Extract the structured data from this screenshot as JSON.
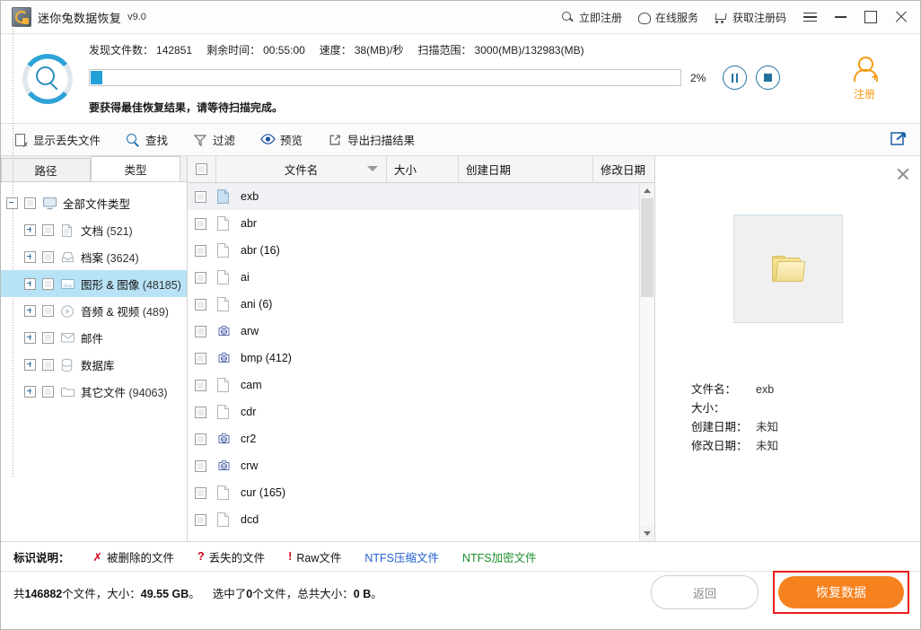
{
  "titlebar": {
    "app_name": "迷你兔数据恢复",
    "version": "v9.0",
    "links": [
      {
        "label": "立即注册",
        "icon": "search-icon"
      },
      {
        "label": "在线服务",
        "icon": "headset-icon"
      },
      {
        "label": "获取注册码",
        "icon": "cart-icon"
      }
    ],
    "window_controls": [
      "menu-icon",
      "minimize-icon",
      "maximize-icon",
      "close-icon"
    ]
  },
  "scan": {
    "stats": [
      {
        "label": "发现文件数：",
        "value": "142851"
      },
      {
        "label": "剩余时间：",
        "value": "00:55:00"
      },
      {
        "label": "速度：",
        "value": "38(MB)/秒"
      },
      {
        "label": "扫描范围：",
        "value": "3000(MB)/132983(MB)"
      }
    ],
    "progress_percent": "2%",
    "progress_value": 2,
    "hint": "要获得最佳恢复结果，请等待扫描完成。",
    "pause_label": "pause-button",
    "stop_label": "stop-button",
    "register_label": "注册",
    "accent_color": "#22a0d8",
    "register_color": "#f59a12"
  },
  "toolbar": {
    "items": [
      {
        "label": "显示丢失文件",
        "icon": "document-missing-icon"
      },
      {
        "label": "查找",
        "icon": "search-icon"
      },
      {
        "label": "过滤",
        "icon": "filter-icon"
      },
      {
        "label": "预览",
        "icon": "eye-icon"
      },
      {
        "label": "导出扫描结果",
        "icon": "export-icon"
      }
    ],
    "share_icon": "share-export-icon"
  },
  "left_panel": {
    "tabs": [
      {
        "label": "路径",
        "active": false
      },
      {
        "label": "类型",
        "active": true
      }
    ],
    "tree": [
      {
        "label": "全部文件类型",
        "count": "",
        "icon": "monitor-icon",
        "level": 0,
        "expander": "minus",
        "selected": false
      },
      {
        "label": "文档",
        "count": "(521)",
        "icon": "document-icon",
        "level": 1,
        "expander": "plus",
        "selected": false
      },
      {
        "label": "档案",
        "count": "(3624)",
        "icon": "archive-icon",
        "level": 1,
        "expander": "plus",
        "selected": false
      },
      {
        "label": "图形 & 图像",
        "count": "(48185)",
        "icon": "image-icon",
        "level": 1,
        "expander": "plus",
        "selected": true
      },
      {
        "label": "音频 & 视频",
        "count": "(489)",
        "icon": "media-icon",
        "level": 1,
        "expander": "plus",
        "selected": false
      },
      {
        "label": "邮件",
        "count": "",
        "icon": "mail-icon",
        "level": 1,
        "expander": "plus",
        "selected": false
      },
      {
        "label": "数据库",
        "count": "",
        "icon": "database-icon",
        "level": 1,
        "expander": "plus",
        "selected": false
      },
      {
        "label": "其它文件",
        "count": "(94063)",
        "icon": "folder-icon",
        "level": 1,
        "expander": "plus",
        "selected": false
      }
    ]
  },
  "file_list": {
    "columns": [
      {
        "label": "文件名",
        "sorted": "desc"
      },
      {
        "label": "大小",
        "sorted": ""
      },
      {
        "label": "创建日期",
        "sorted": ""
      },
      {
        "label": "修改日期",
        "sorted": ""
      }
    ],
    "rows": [
      {
        "name": "exb",
        "icon": "blue-file-icon",
        "size": "",
        "created": "",
        "modified": "",
        "selected": true
      },
      {
        "name": "abr",
        "icon": "file-icon",
        "size": "",
        "created": "",
        "modified": "",
        "selected": false
      },
      {
        "name": "abr (16)",
        "icon": "file-icon",
        "size": "",
        "created": "",
        "modified": "",
        "selected": false
      },
      {
        "name": "ai",
        "icon": "file-icon",
        "size": "",
        "created": "",
        "modified": "",
        "selected": false
      },
      {
        "name": "ani (6)",
        "icon": "file-icon",
        "size": "",
        "created": "",
        "modified": "",
        "selected": false
      },
      {
        "name": "arw",
        "icon": "raw-file-icon",
        "size": "",
        "created": "",
        "modified": "",
        "selected": false
      },
      {
        "name": "bmp (412)",
        "icon": "bmp-file-icon",
        "size": "",
        "created": "",
        "modified": "",
        "selected": false
      },
      {
        "name": "cam",
        "icon": "file-icon",
        "size": "",
        "created": "",
        "modified": "",
        "selected": false
      },
      {
        "name": "cdr",
        "icon": "file-icon",
        "size": "",
        "created": "",
        "modified": "",
        "selected": false
      },
      {
        "name": "cr2",
        "icon": "raw-file-icon",
        "size": "",
        "created": "",
        "modified": "",
        "selected": false
      },
      {
        "name": "crw",
        "icon": "raw-file-icon",
        "size": "",
        "created": "",
        "modified": "",
        "selected": false
      },
      {
        "name": "cur (165)",
        "icon": "file-icon",
        "size": "",
        "created": "",
        "modified": "",
        "selected": false
      },
      {
        "name": "dcd",
        "icon": "file-icon",
        "size": "",
        "created": "",
        "modified": "",
        "selected": false
      }
    ]
  },
  "preview": {
    "thumbnail_icon": "folder-thumbnail",
    "fields": [
      {
        "key": "文件名：",
        "value": "exb"
      },
      {
        "key": "大小：",
        "value": ""
      },
      {
        "key": "创建日期：",
        "value": "未知"
      },
      {
        "key": "修改日期：",
        "value": "未知"
      }
    ]
  },
  "legend": {
    "title": "标识说明：",
    "items": [
      {
        "mark": "✗",
        "label": "被删除的文件",
        "mark_color": "#d0021b",
        "label_color": "#111111"
      },
      {
        "mark": "?",
        "label": "丢失的文件",
        "mark_color": "#d0021b",
        "label_color": "#111111"
      },
      {
        "mark": "!",
        "label": "Raw文件",
        "mark_color": "#d0021b",
        "label_color": "#111111"
      },
      {
        "mark": "",
        "label": "NTFS压缩文件",
        "mark_color": "",
        "label_color": "#1f5fd0"
      },
      {
        "mark": "",
        "label": "NTFS加密文件",
        "mark_color": "",
        "label_color": "#1a8f2a"
      }
    ]
  },
  "statusbar": {
    "total_prefix": "共",
    "total_count": "146882",
    "total_mid": "个文件，大小：",
    "total_size": "49.55 GB",
    "total_suffix": "。",
    "sel_prefix": "选中了",
    "sel_count": "0",
    "sel_mid": "个文件，总共大小：",
    "sel_size": "0 B",
    "sel_suffix": "。",
    "back_label": "返回",
    "recover_label": "恢复数据",
    "recover_color": "#f5821f",
    "highlight_color": "#f01c1c"
  }
}
